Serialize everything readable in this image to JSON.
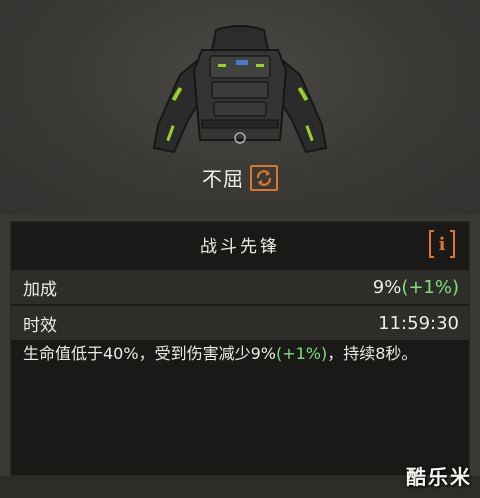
{
  "item": {
    "name": "不屈",
    "swap_icon": "refresh-icon"
  },
  "panel": {
    "title": "战斗先锋",
    "info_icon": "info-icon",
    "rows": [
      {
        "label": "加成",
        "value": "9%",
        "bonus": "(+1%)"
      },
      {
        "label": "时效",
        "value": "11:59:30"
      }
    ],
    "description": {
      "text_before": "生命值低于40%，受到伤害减少9%",
      "bonus": "(+1%)",
      "text_after": "，持续8秒。"
    }
  },
  "watermark": "酷乐米",
  "colors": {
    "accent": "#d9782a",
    "bonus_green": "#7fe07a",
    "panel_bg": "#1a1917",
    "row_bg": "#2e2d2a"
  }
}
